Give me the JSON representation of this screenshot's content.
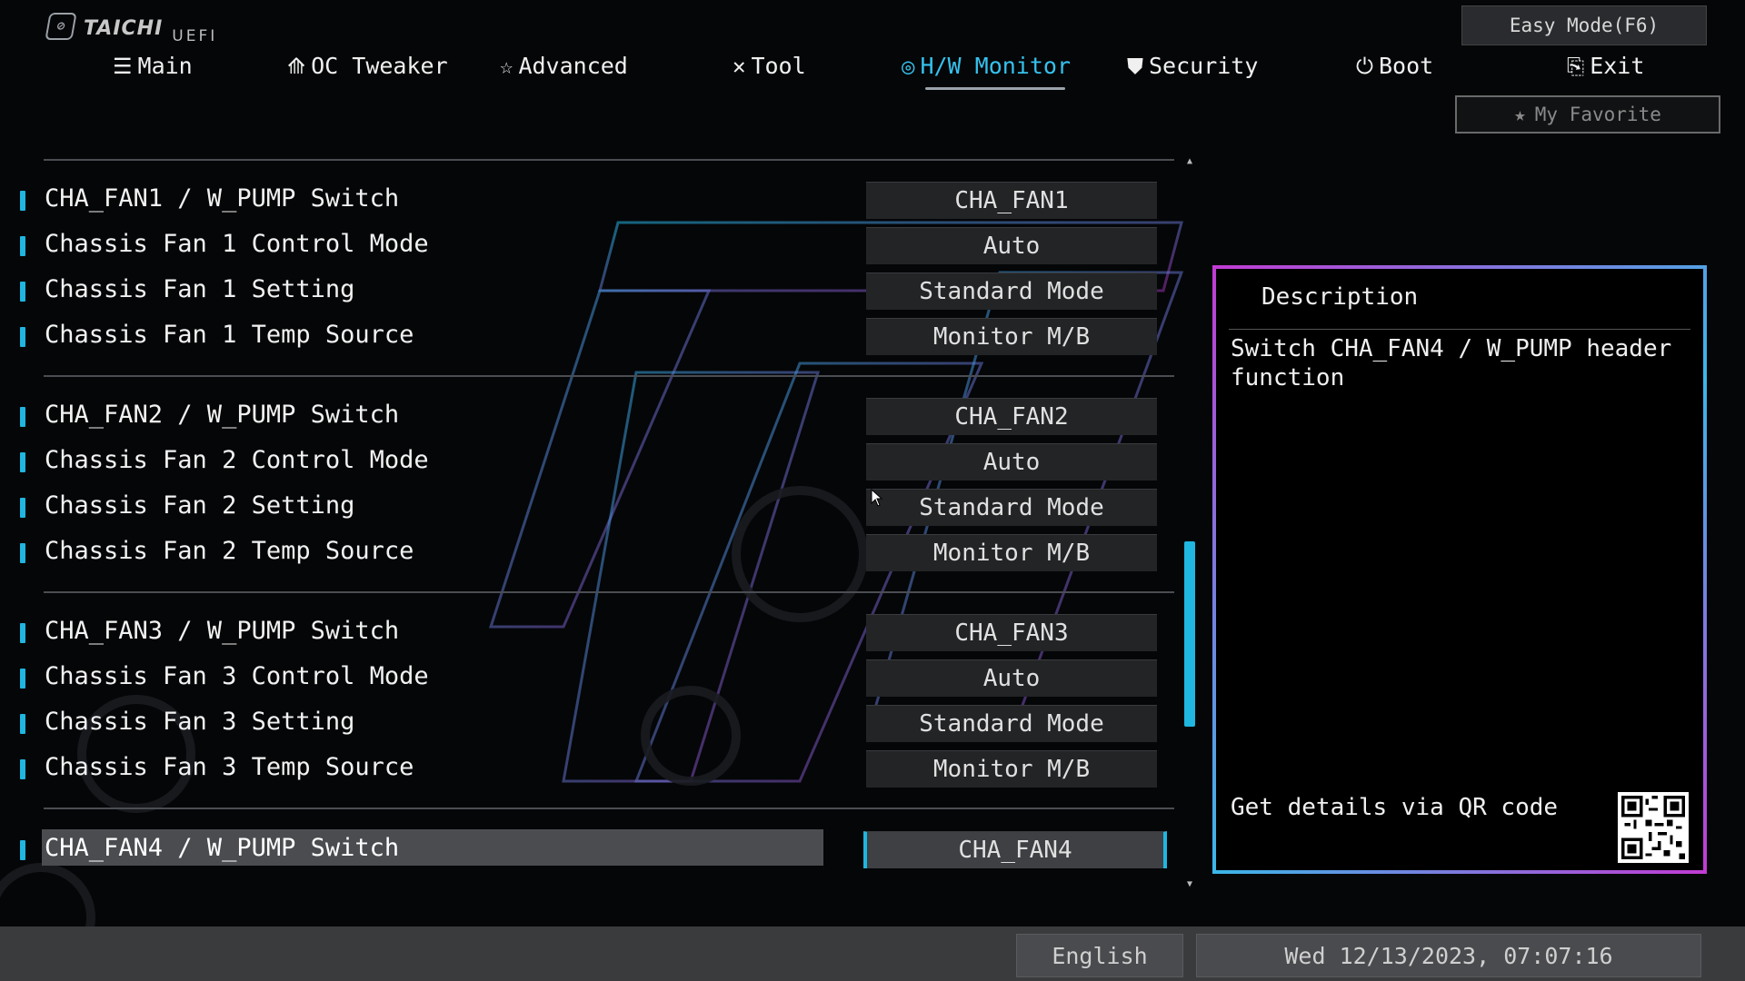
{
  "logo": {
    "brand": "TAICHI",
    "sub": "UEFI"
  },
  "nav": [
    {
      "label": "Main",
      "icon": "list-icon"
    },
    {
      "label": "OC Tweaker",
      "icon": "rocket-icon"
    },
    {
      "label": "Advanced",
      "icon": "star-icon"
    },
    {
      "label": "Tool",
      "icon": "tools-icon"
    },
    {
      "label": "H/W Monitor",
      "icon": "monitor-target-icon",
      "active": true
    },
    {
      "label": "Security",
      "icon": "shield-icon"
    },
    {
      "label": "Boot",
      "icon": "power-icon"
    },
    {
      "label": "Exit",
      "icon": "exit-door-icon"
    }
  ],
  "easy_mode": "Easy Mode(F6)",
  "favorite": "My Favorite",
  "settings": [
    {
      "label": "CHA_FAN1 / W_PUMP Switch",
      "value": "CHA_FAN1"
    },
    {
      "label": "Chassis Fan 1 Control Mode",
      "value": "Auto"
    },
    {
      "label": "Chassis Fan 1 Setting",
      "value": "Standard Mode"
    },
    {
      "label": "Chassis Fan 1 Temp Source",
      "value": "Monitor M/B"
    },
    {
      "label": "CHA_FAN2 / W_PUMP Switch",
      "value": "CHA_FAN2"
    },
    {
      "label": "Chassis Fan 2 Control Mode",
      "value": "Auto"
    },
    {
      "label": "Chassis Fan 2 Setting",
      "value": "Standard Mode"
    },
    {
      "label": "Chassis Fan 2 Temp Source",
      "value": "Monitor M/B"
    },
    {
      "label": "CHA_FAN3 / W_PUMP Switch",
      "value": "CHA_FAN3"
    },
    {
      "label": "Chassis Fan 3 Control Mode",
      "value": "Auto"
    },
    {
      "label": "Chassis Fan 3 Setting",
      "value": "Standard Mode"
    },
    {
      "label": "Chassis Fan 3 Temp Source",
      "value": "Monitor M/B"
    },
    {
      "label": "CHA_FAN4 / W_PUMP Switch",
      "value": "CHA_FAN4",
      "selected": true
    }
  ],
  "description": {
    "title": "Description",
    "text": "Switch CHA_FAN4 / W_PUMP header function",
    "qr_label": "Get details via QR code"
  },
  "footer": {
    "language": "English",
    "datetime": "Wed 12/13/2023, 07:07:16"
  },
  "colors": {
    "accent": "#1fb6e0",
    "panel_border_pink": "#c23bd3",
    "panel_border_cyan": "#3bb7e8"
  }
}
